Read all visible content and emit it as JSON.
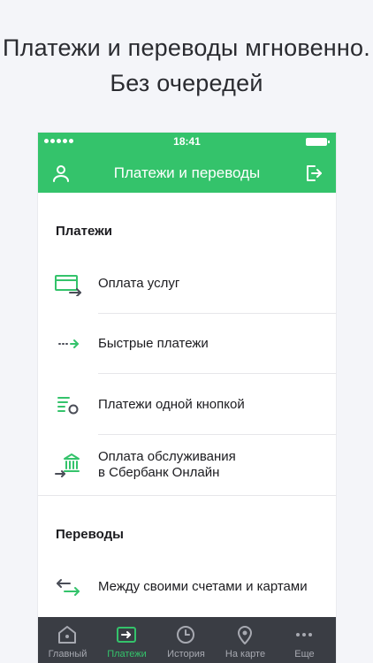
{
  "promo": {
    "line1": "Платежи и переводы мгновенно.",
    "line2": "Без очередей"
  },
  "status_bar": {
    "time": "18:41"
  },
  "header": {
    "title": "Платежи и переводы"
  },
  "sections": {
    "payments": {
      "title": "Платежи",
      "items": [
        {
          "label": "Оплата услуг",
          "icon": "card-arrow-icon"
        },
        {
          "label": "Быстрые платежи",
          "icon": "dashed-arrow-icon"
        },
        {
          "label": "Платежи одной кнопкой",
          "icon": "list-circle-icon"
        },
        {
          "label_line1": "Оплата обслуживания",
          "label_line2": "в Сбербанк Онлайн",
          "icon": "bank-arrow-icon"
        }
      ]
    },
    "transfers": {
      "title": "Переводы",
      "items": [
        {
          "label": "Между своими счетами и картами",
          "icon": "swap-arrows-icon"
        }
      ]
    }
  },
  "tabbar": {
    "items": [
      {
        "label": "Главный",
        "icon": "home-icon",
        "active": false
      },
      {
        "label": "Платежи",
        "icon": "payments-icon",
        "active": true
      },
      {
        "label": "История",
        "icon": "clock-icon",
        "active": false
      },
      {
        "label": "На карте",
        "icon": "map-pin-icon",
        "active": false
      },
      {
        "label": "Еще",
        "icon": "more-dots-icon",
        "active": false
      }
    ]
  },
  "colors": {
    "accent": "#34c36b",
    "tabbar_bg": "#3a3d44",
    "tab_inactive": "#a7a9b1",
    "icon_dark": "#4a4d57"
  }
}
